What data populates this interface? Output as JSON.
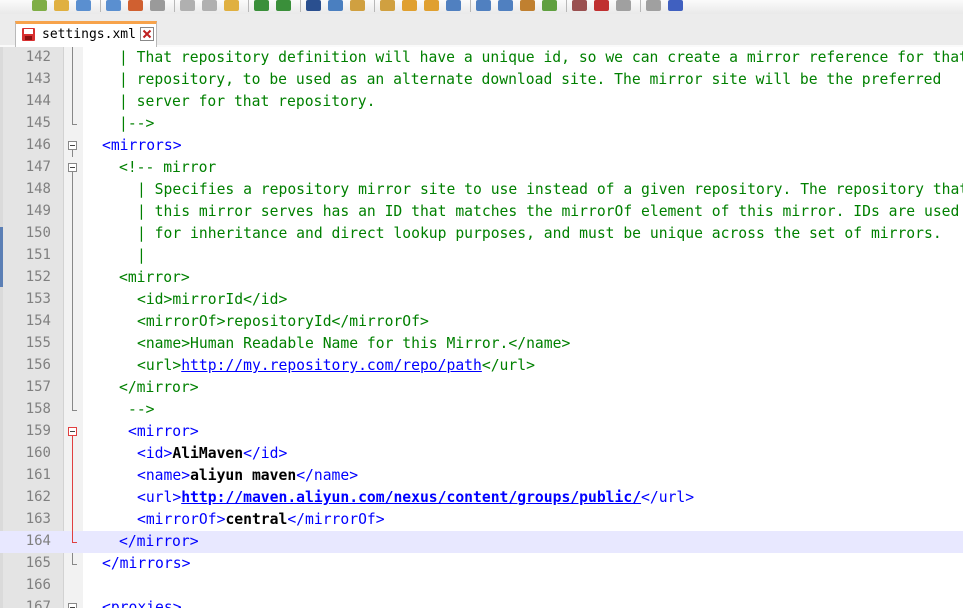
{
  "tab": {
    "label": "settings.xml"
  },
  "editor": {
    "current_line": 164,
    "lines": [
      {
        "num": "142",
        "indent": 2,
        "fold": "vline",
        "segs": [
          {
            "c": "com",
            "t": "| That repository definition will have a unique id, so we can create a mirror reference for that"
          }
        ]
      },
      {
        "num": "143",
        "indent": 2,
        "fold": "vline",
        "segs": [
          {
            "c": "com",
            "t": "| repository, to be used as an alternate download site. The mirror site will be the preferred"
          }
        ]
      },
      {
        "num": "144",
        "indent": 2,
        "fold": "vline",
        "segs": [
          {
            "c": "com",
            "t": "| server for that repository."
          }
        ]
      },
      {
        "num": "145",
        "indent": 2,
        "fold": "end",
        "segs": [
          {
            "c": "com",
            "t": "|-->"
          }
        ]
      },
      {
        "num": "146",
        "indent": 1,
        "fold": "box",
        "segs": [
          {
            "c": "tag",
            "t": "<mirrors>"
          }
        ]
      },
      {
        "num": "147",
        "indent": 2,
        "fold": "box",
        "segs": [
          {
            "c": "com",
            "t": "<!-- mirror"
          }
        ]
      },
      {
        "num": "148",
        "indent": 3,
        "fold": "vline",
        "segs": [
          {
            "c": "com",
            "t": "| Specifies a repository mirror site to use instead of a given repository. The repository that"
          }
        ]
      },
      {
        "num": "149",
        "indent": 3,
        "fold": "vline",
        "segs": [
          {
            "c": "com",
            "t": "| this mirror serves has an ID that matches the mirrorOf element of this mirror. IDs are used"
          }
        ]
      },
      {
        "num": "150",
        "indent": 3,
        "fold": "vline",
        "segs": [
          {
            "c": "com",
            "t": "| for inheritance and direct lookup purposes, and must be unique across the set of mirrors."
          }
        ]
      },
      {
        "num": "151",
        "indent": 3,
        "fold": "vline",
        "segs": [
          {
            "c": "com",
            "t": "|"
          }
        ]
      },
      {
        "num": "152",
        "indent": 2,
        "fold": "vline",
        "segs": [
          {
            "c": "com",
            "t": "<mirror>"
          }
        ]
      },
      {
        "num": "153",
        "indent": 3,
        "fold": "vline",
        "segs": [
          {
            "c": "com",
            "t": "<id>mirrorId</id>"
          }
        ]
      },
      {
        "num": "154",
        "indent": 3,
        "fold": "vline",
        "segs": [
          {
            "c": "com",
            "t": "<mirrorOf>repositoryId</mirrorOf>"
          }
        ]
      },
      {
        "num": "155",
        "indent": 3,
        "fold": "vline",
        "segs": [
          {
            "c": "com",
            "t": "<name>Human Readable Name for this Mirror.</name>"
          }
        ]
      },
      {
        "num": "156",
        "indent": 3,
        "fold": "vline",
        "segs": [
          {
            "c": "com",
            "t": "<url>"
          },
          {
            "c": "url",
            "t": "http://my.repository.com/repo/path"
          },
          {
            "c": "com",
            "t": "</url>"
          }
        ]
      },
      {
        "num": "157",
        "indent": 2,
        "fold": "vline",
        "segs": [
          {
            "c": "com",
            "t": "</mirror>"
          }
        ]
      },
      {
        "num": "158",
        "indent": 2.5,
        "fold": "end",
        "segs": [
          {
            "c": "com",
            "t": "-->"
          }
        ]
      },
      {
        "num": "159",
        "indent": 2.5,
        "fold": "boxred",
        "segs": [
          {
            "c": "tag",
            "t": "<mirror>"
          }
        ]
      },
      {
        "num": "160",
        "indent": 3,
        "fold": "vlinered",
        "segs": [
          {
            "c": "tag",
            "t": "<id>"
          },
          {
            "c": "bold",
            "t": "AliMaven"
          },
          {
            "c": "tag",
            "t": "</id>"
          }
        ]
      },
      {
        "num": "161",
        "indent": 3,
        "fold": "vlinered",
        "segs": [
          {
            "c": "tag",
            "t": "<name>"
          },
          {
            "c": "bold",
            "t": "aliyun maven"
          },
          {
            "c": "tag",
            "t": "</name>"
          }
        ]
      },
      {
        "num": "162",
        "indent": 3,
        "fold": "vlinered",
        "segs": [
          {
            "c": "tag",
            "t": "<url>"
          },
          {
            "c": "url bold",
            "t": "http://maven.aliyun.com/nexus/content/groups/public/"
          },
          {
            "c": "tag",
            "t": "</url>"
          }
        ]
      },
      {
        "num": "163",
        "indent": 3,
        "fold": "vlinered",
        "segs": [
          {
            "c": "tag",
            "t": "<mirrorOf>"
          },
          {
            "c": "bold",
            "t": "central"
          },
          {
            "c": "tag",
            "t": "</mirrorOf>"
          }
        ]
      },
      {
        "num": "164",
        "indent": 2,
        "fold": "endred",
        "segs": [
          {
            "c": "tag",
            "t": "</mirror>"
          }
        ]
      },
      {
        "num": "165",
        "indent": 1,
        "fold": "end",
        "segs": [
          {
            "c": "tag",
            "t": "</mirrors>"
          }
        ]
      },
      {
        "num": "166",
        "indent": 0,
        "fold": "none",
        "segs": [
          {
            "c": "txt",
            "t": ""
          }
        ]
      },
      {
        "num": "167",
        "indent": 1,
        "fold": "box",
        "segs": [
          {
            "c": "tag",
            "t": "<proxies>"
          }
        ]
      }
    ]
  },
  "colors": {
    "tag": "#0000ff",
    "comment": "#008000",
    "current_line_bg": "#e8e8ff",
    "fold_active": "#e04040",
    "tab_accent": "#f7a34b"
  },
  "icons": [
    "new-file-icon",
    "open-icon",
    "save-icon",
    "save-all-icon",
    "close-icon",
    "print-icon",
    "cut-icon",
    "copy-icon",
    "paste-icon",
    "undo-icon",
    "redo-icon",
    "find-icon",
    "replace-icon",
    "zoom-in-icon",
    "zoom-out-icon",
    "sync-icon",
    "wrap-icon",
    "indent-guide-icon",
    "macro-record-icon",
    "macro-play-icon"
  ]
}
